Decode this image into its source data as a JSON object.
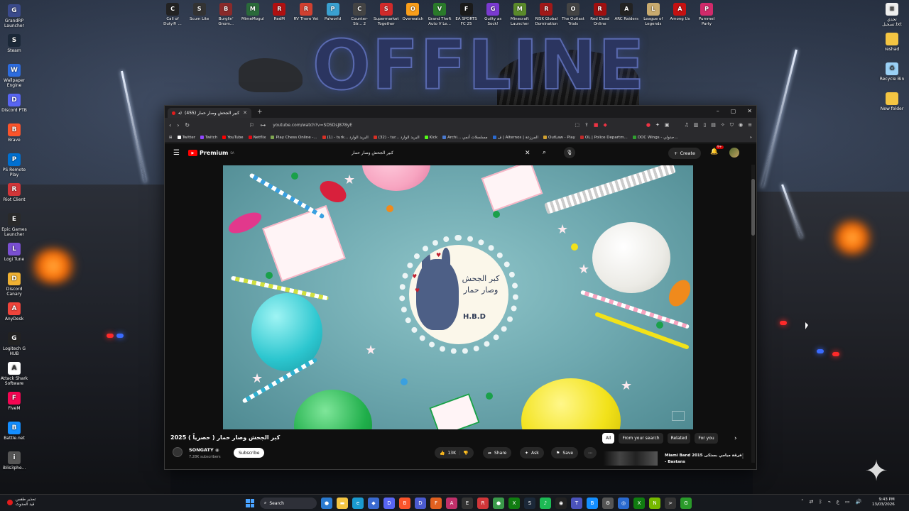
{
  "wallpaper": {
    "headline": "OFFLINE"
  },
  "desktop_left": [
    {
      "label": "GrandRP Launcher",
      "icon": "gamepad-icon",
      "color": "#3a4a8c",
      "glyph": "G"
    },
    {
      "label": "Steam",
      "icon": "steam-icon",
      "color": "#1b2838",
      "glyph": "S"
    },
    {
      "label": "Wallpaper Engine",
      "icon": "wallpaper-engine-icon",
      "color": "#2d6cdf",
      "glyph": "W"
    },
    {
      "label": "Discord PTB",
      "icon": "discord-icon",
      "color": "#5865f2",
      "glyph": "D"
    },
    {
      "label": "Brave",
      "icon": "brave-icon",
      "color": "#fb542b",
      "glyph": "B"
    },
    {
      "label": "PS Remote Play",
      "icon": "playstation-icon",
      "color": "#0070d1",
      "glyph": "P"
    },
    {
      "label": "Riot Client",
      "icon": "riot-icon",
      "color": "#d13639",
      "glyph": "R"
    },
    {
      "label": "Epic Games Launcher",
      "icon": "epic-games-icon",
      "color": "#2a2a2a",
      "glyph": "E"
    },
    {
      "label": "Logi Tune",
      "icon": "logi-tune-icon",
      "color": "#7a4fd1",
      "glyph": "L"
    },
    {
      "label": "Discord Canary",
      "icon": "discord-canary-icon",
      "color": "#f0b132",
      "glyph": "D"
    },
    {
      "label": "AnyDesk",
      "icon": "anydesk-icon",
      "color": "#ef443b",
      "glyph": "A"
    },
    {
      "label": "Logitech G HUB",
      "icon": "logitech-icon",
      "color": "#222",
      "glyph": "G"
    },
    {
      "label": "Attack Shark Software",
      "icon": "shark-icon",
      "color": "#ffffff",
      "glyph": "A"
    },
    {
      "label": "FiveM",
      "icon": "fivem-icon",
      "color": "#f40552",
      "glyph": "F"
    },
    {
      "label": "Battle.net",
      "icon": "battlenet-icon",
      "color": "#148eff",
      "glyph": "B"
    },
    {
      "label": "iblis3phe...",
      "icon": "folder-icon",
      "color": "#555",
      "glyph": "i"
    }
  ],
  "desktop_top": [
    {
      "label": "Call of Duty® ...",
      "icon": "cod-icon",
      "color": "#222",
      "glyph": "C"
    },
    {
      "label": "Scum Lite",
      "icon": "scum-icon",
      "color": "#333",
      "glyph": "S"
    },
    {
      "label": "Burglin' Gnom...",
      "icon": "gnome-icon",
      "color": "#8a2a2a",
      "glyph": "B"
    },
    {
      "label": "MimeMogul",
      "icon": "mime-icon",
      "color": "#2a6a3a",
      "glyph": "M"
    },
    {
      "label": "RedM",
      "icon": "redm-icon",
      "color": "#b01010",
      "glyph": "R"
    },
    {
      "label": "RV There Yet",
      "icon": "rv-icon",
      "color": "#d04030",
      "glyph": "R"
    },
    {
      "label": "Palworld",
      "icon": "palworld-icon",
      "color": "#3aa0d0",
      "glyph": "P"
    },
    {
      "label": "Counter-Str... 2",
      "icon": "cs2-icon",
      "color": "#444",
      "glyph": "C"
    },
    {
      "label": "Supermarket Together",
      "icon": "supermarket-icon",
      "color": "#d02a2a",
      "glyph": "S"
    },
    {
      "label": "Overwatch",
      "icon": "overwatch-icon",
      "color": "#f99e1a",
      "glyph": "O"
    },
    {
      "label": "Grand Theft Auto V Le...",
      "icon": "gta-icon",
      "color": "#2a7a2a",
      "glyph": "V"
    },
    {
      "label": "EA SPORTS FC 25",
      "icon": "fc25-icon",
      "color": "#1a1a1a",
      "glyph": "F"
    },
    {
      "label": "Guilty as Sock!",
      "icon": "sock-icon",
      "color": "#7a3ad0",
      "glyph": "G"
    },
    {
      "label": "Minecraft Launcher",
      "icon": "minecraft-icon",
      "color": "#5a8a2a",
      "glyph": "M"
    },
    {
      "label": "RISK Global Domination",
      "icon": "risk-icon",
      "color": "#a01818",
      "glyph": "R"
    },
    {
      "label": "The Outlast Trials",
      "icon": "outlast-icon",
      "color": "#444",
      "glyph": "O"
    },
    {
      "label": "Red Dead Online",
      "icon": "rdo-icon",
      "color": "#a01010",
      "glyph": "R"
    },
    {
      "label": "ARC Raiders",
      "icon": "arc-icon",
      "color": "#222",
      "glyph": "A"
    },
    {
      "label": "League of Legends",
      "icon": "lol-icon",
      "color": "#c8aa6e",
      "glyph": "L"
    },
    {
      "label": "Among Us",
      "icon": "amongus-icon",
      "color": "#c51111",
      "glyph": "A"
    },
    {
      "label": "Pummel Party",
      "icon": "pummel-icon",
      "color": "#d02a6a",
      "glyph": "P"
    }
  ],
  "desktop_right": [
    {
      "label": "تحدي تسجيل.txt",
      "icon": "text-file-icon",
      "color": "#eeeeee",
      "glyph": "≡"
    },
    {
      "label": "reshad",
      "icon": "folder-icon",
      "color": "#f4c542",
      "glyph": " "
    },
    {
      "label": "Recycle Bin",
      "icon": "recycle-bin-icon",
      "color": "#9ad0f5",
      "glyph": "♻"
    },
    {
      "label": "New folder",
      "icon": "folder-icon",
      "color": "#f4c542",
      "glyph": " "
    }
  ],
  "browser": {
    "tab_title": "(455) كبير الجحش وصار حمار :(",
    "url": "youtube.com/watch?v=SD5DsJ878yE",
    "bookmarks": [
      {
        "label": "Twitter",
        "color": "#ffffff"
      },
      {
        "label": "Twitch",
        "color": "#9146ff"
      },
      {
        "label": "YouTube",
        "color": "#ff0000"
      },
      {
        "label": "Netflix",
        "color": "#e50914"
      },
      {
        "label": "Play Chess Online -...",
        "color": "#7fa650"
      },
      {
        "label": "(1) - turk... البريد الوارد",
        "color": "#d93025"
      },
      {
        "label": "(32) - tur... البريد الوارد",
        "color": "#d93025"
      },
      {
        "label": "Kick",
        "color": "#53fc18"
      },
      {
        "label": "Archi... مسلسلات أنمي",
        "color": "#4a7ad0"
      },
      {
        "label": "ف | Alternos | المرزعة",
        "color": "#2a6ad0"
      },
      {
        "label": "OutLaw - Play",
        "color": "#d0a030"
      },
      {
        "label": "OL | Police Departm...",
        "color": "#c02a2a"
      },
      {
        "label": "DOC Wings - جدولي...",
        "color": "#30a030"
      }
    ]
  },
  "youtube": {
    "logo": "Premium",
    "logo_country": "SA",
    "search_query": "كبير الجحش وصار حمار",
    "create_label": "Create",
    "notif_count": "9+",
    "video_title": "كبر الجحش وصار حمار ( حصرياً ) 2025",
    "plate_text_line1": "كبر الجحش",
    "plate_text_line2": "وصار حمار",
    "plate_hbd": "H.B.D",
    "channel_name": "SONGATY",
    "subscribers": "7.28K subscribers",
    "subscribe_label": "Subscribe",
    "likes": "13K",
    "share_label": "Share",
    "ask_label": "Ask",
    "save_label": "Save",
    "chips": [
      "All",
      "From your search",
      "Related",
      "For you"
    ],
    "rec_title_line1": "Miami Band 2015 فرقة ميامي بستكى",
    "rec_title_line2": "- Bastans"
  },
  "taskbar": {
    "weather_line1": "تحذير طقس",
    "weather_line2": "قيد الحدوث",
    "search_label": "Search",
    "apps": [
      {
        "icon": "chrome-icon",
        "color": "#2a7ad0",
        "glyph": "●"
      },
      {
        "icon": "file-explorer-icon",
        "color": "#f4c542",
        "glyph": "▬"
      },
      {
        "icon": "edge-icon",
        "color": "#1a9ad0",
        "glyph": "e"
      },
      {
        "icon": "copilot-icon",
        "color": "#3a6ad0",
        "glyph": "◆"
      },
      {
        "icon": "discord-icon",
        "color": "#5865f2",
        "glyph": "D"
      },
      {
        "icon": "brave-icon",
        "color": "#fb542b",
        "glyph": "B"
      },
      {
        "icon": "discord-ptb-icon",
        "color": "#4a5ad0",
        "glyph": "D"
      },
      {
        "icon": "firefox-icon",
        "color": "#e06020",
        "glyph": "F"
      },
      {
        "icon": "arc-icon",
        "color": "#c0306a",
        "glyph": "A"
      },
      {
        "icon": "epic-icon",
        "color": "#333",
        "glyph": "E"
      },
      {
        "icon": "riot-icon",
        "color": "#d13639",
        "glyph": "R"
      },
      {
        "icon": "chrome-icon",
        "color": "#3a9a4a",
        "glyph": "●"
      },
      {
        "icon": "xbox-icon",
        "color": "#107c10",
        "glyph": "X"
      },
      {
        "icon": "steam-icon",
        "color": "#1b2838",
        "glyph": "S"
      },
      {
        "icon": "spotify-icon",
        "color": "#1db954",
        "glyph": "♪"
      },
      {
        "icon": "obs-icon",
        "color": "#222",
        "glyph": "◉"
      },
      {
        "icon": "teams-icon",
        "color": "#4b53bc",
        "glyph": "T"
      },
      {
        "icon": "battlenet-icon",
        "color": "#148eff",
        "glyph": "B"
      },
      {
        "icon": "settings-icon",
        "color": "#555",
        "glyph": "⚙"
      },
      {
        "icon": "browser-icon",
        "color": "#2a6ad0",
        "glyph": "◎"
      },
      {
        "icon": "xbox-app-icon",
        "color": "#107c10",
        "glyph": "X"
      },
      {
        "icon": "nvidia-icon",
        "color": "#76b900",
        "glyph": "N"
      },
      {
        "icon": "terminal-icon",
        "color": "#333",
        "glyph": ">"
      },
      {
        "icon": "game-icon",
        "color": "#2a9a2a",
        "glyph": "G"
      }
    ],
    "time": "9:43 PM",
    "date": "13/03/2026",
    "lang": "ع"
  }
}
